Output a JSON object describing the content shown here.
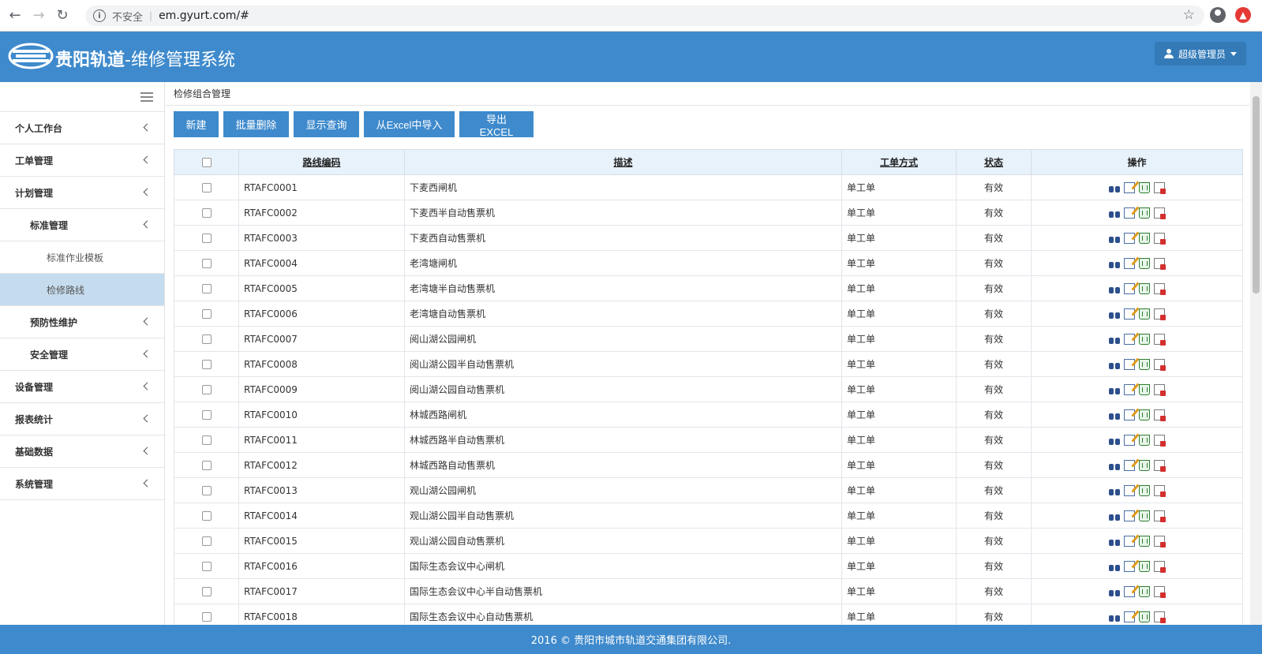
{
  "browser": {
    "insecure_label": "不安全",
    "url": "em.gyurt.com/#"
  },
  "header": {
    "brand": "贵阳轨道",
    "subtitle": "-维修管理系统",
    "user": "超级管理员"
  },
  "sidebar": {
    "items": [
      {
        "label": "个人工作台",
        "level": 0,
        "chevron": true
      },
      {
        "label": "工单管理",
        "level": 0,
        "chevron": true
      },
      {
        "label": "计划管理",
        "level": 0,
        "chevron": true
      },
      {
        "label": "标准管理",
        "level": 1,
        "chevron": true
      },
      {
        "label": "标准作业模板",
        "level": 2,
        "chevron": false
      },
      {
        "label": "检修路线",
        "level": 2,
        "chevron": false,
        "active": true
      },
      {
        "label": "预防性维护",
        "level": 1,
        "chevron": true
      },
      {
        "label": "安全管理",
        "level": 1,
        "chevron": true
      },
      {
        "label": "设备管理",
        "level": 0,
        "chevron": true
      },
      {
        "label": "报表统计",
        "level": 0,
        "chevron": true
      },
      {
        "label": "基础数据",
        "level": 0,
        "chevron": true
      },
      {
        "label": "系统管理",
        "level": 0,
        "chevron": true
      }
    ]
  },
  "breadcrumb": "检修组合管理",
  "toolbar": {
    "new": "新建",
    "batch_delete": "批量删除",
    "show_query": "显示查询",
    "import_excel": "从Excel中导入",
    "export_excel": "导出EXCEL"
  },
  "table": {
    "headers": {
      "code": "路线编码",
      "desc": "描述",
      "method": "工单方式",
      "status": "状态",
      "ops": "操作"
    },
    "rows": [
      {
        "code": "RTAFC0001",
        "desc": "下麦西闸机",
        "method": "单工单",
        "status": "有效"
      },
      {
        "code": "RTAFC0002",
        "desc": "下麦西半自动售票机",
        "method": "单工单",
        "status": "有效"
      },
      {
        "code": "RTAFC0003",
        "desc": "下麦西自动售票机",
        "method": "单工单",
        "status": "有效"
      },
      {
        "code": "RTAFC0004",
        "desc": "老湾塘闸机",
        "method": "单工单",
        "status": "有效"
      },
      {
        "code": "RTAFC0005",
        "desc": "老湾塘半自动售票机",
        "method": "单工单",
        "status": "有效"
      },
      {
        "code": "RTAFC0006",
        "desc": "老湾塘自动售票机",
        "method": "单工单",
        "status": "有效"
      },
      {
        "code": "RTAFC0007",
        "desc": "阅山湖公园闸机",
        "method": "单工单",
        "status": "有效"
      },
      {
        "code": "RTAFC0008",
        "desc": "阅山湖公园半自动售票机",
        "method": "单工单",
        "status": "有效"
      },
      {
        "code": "RTAFC0009",
        "desc": "阅山湖公园自动售票机",
        "method": "单工单",
        "status": "有效"
      },
      {
        "code": "RTAFC0010",
        "desc": "林城西路闸机",
        "method": "单工单",
        "status": "有效"
      },
      {
        "code": "RTAFC0011",
        "desc": "林城西路半自动售票机",
        "method": "单工单",
        "status": "有效"
      },
      {
        "code": "RTAFC0012",
        "desc": "林城西路自动售票机",
        "method": "单工单",
        "status": "有效"
      },
      {
        "code": "RTAFC0013",
        "desc": "观山湖公园闸机",
        "method": "单工单",
        "status": "有效"
      },
      {
        "code": "RTAFC0014",
        "desc": "观山湖公园半自动售票机",
        "method": "单工单",
        "status": "有效"
      },
      {
        "code": "RTAFC0015",
        "desc": "观山湖公园自动售票机",
        "method": "单工单",
        "status": "有效"
      },
      {
        "code": "RTAFC0016",
        "desc": "国际生态会议中心闸机",
        "method": "单工单",
        "status": "有效"
      },
      {
        "code": "RTAFC0017",
        "desc": "国际生态会议中心半自动售票机",
        "method": "单工单",
        "status": "有效"
      },
      {
        "code": "RTAFC0018",
        "desc": "国际生态会议中心自动售票机",
        "method": "单工单",
        "status": "有效"
      }
    ]
  },
  "footer": "2016 © 贵阳市城市轨道交通集团有限公司.",
  "colors": {
    "primary": "#3e8acc",
    "active_item": "#c5dcee",
    "table_header": "#e8f2fb"
  }
}
